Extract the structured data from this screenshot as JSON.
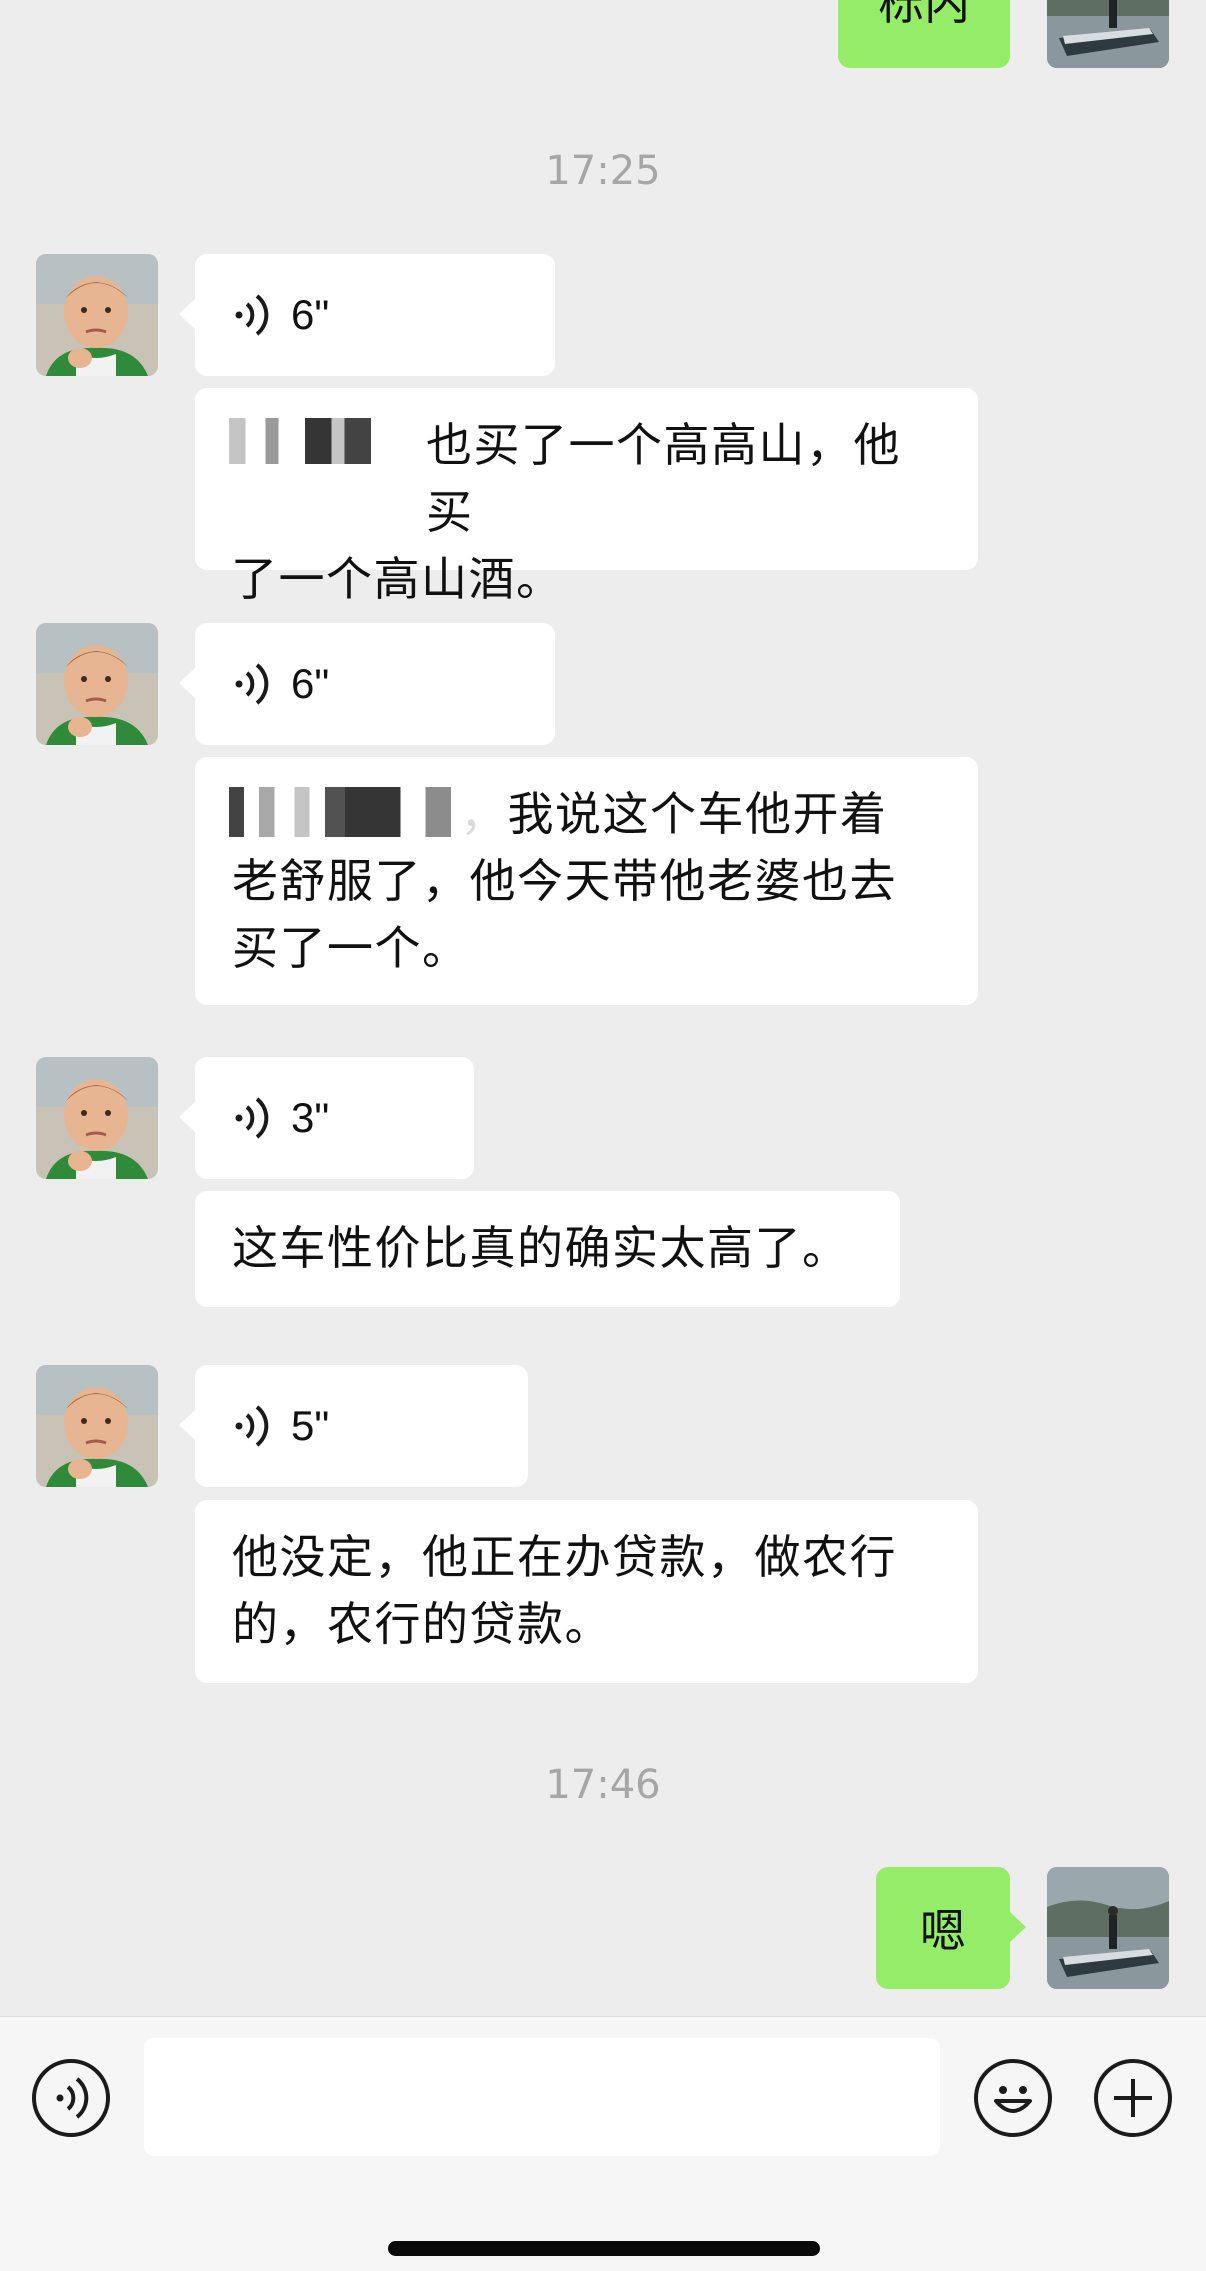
{
  "conversation": {
    "top_outgoing_text": "栎内",
    "timestamp_1": "17:25",
    "timestamp_2": "17:46",
    "messages": [
      {
        "voice_duration": "6\"",
        "transcript_visible": "也买了一个高高山，他买了一个高山酒。",
        "transcript_lines": [
          "也买了一个高高山，他买",
          "了一个高山酒。"
        ]
      },
      {
        "voice_duration": "6\"",
        "transcript_visible": "，我说这个车他开着老舒服了，他今天带他老婆也去买了一个。",
        "transcript_lines": [
          "，我说这个车他开着",
          "老舒服了，他今天带他老婆也去",
          "买了一个。"
        ]
      },
      {
        "voice_duration": "3\"",
        "transcript_visible": "这车性价比真的确实太高了。",
        "transcript_lines": [
          "这车性价比真的确实太高了。"
        ]
      },
      {
        "voice_duration": "5\"",
        "transcript_visible": "他没定，他正在办贷款，做农行的，农行的贷款。",
        "transcript_lines": [
          "他没定，他正在办贷款，做农行",
          "的，农行的贷款。"
        ]
      }
    ],
    "last_outgoing_text": "嗯"
  },
  "icons": {
    "voice_playback": "voice-wave-icon",
    "voice_input": "voice-input-icon",
    "emoji": "emoji-icon",
    "plus": "plus-icon"
  },
  "input": {
    "value": "",
    "placeholder": ""
  },
  "colors": {
    "background": "#ededed",
    "incoming_bubble": "#ffffff",
    "outgoing_bubble": "#95ec69",
    "timestamp": "#a6a6a6",
    "toolbar": "#f6f6f6"
  }
}
